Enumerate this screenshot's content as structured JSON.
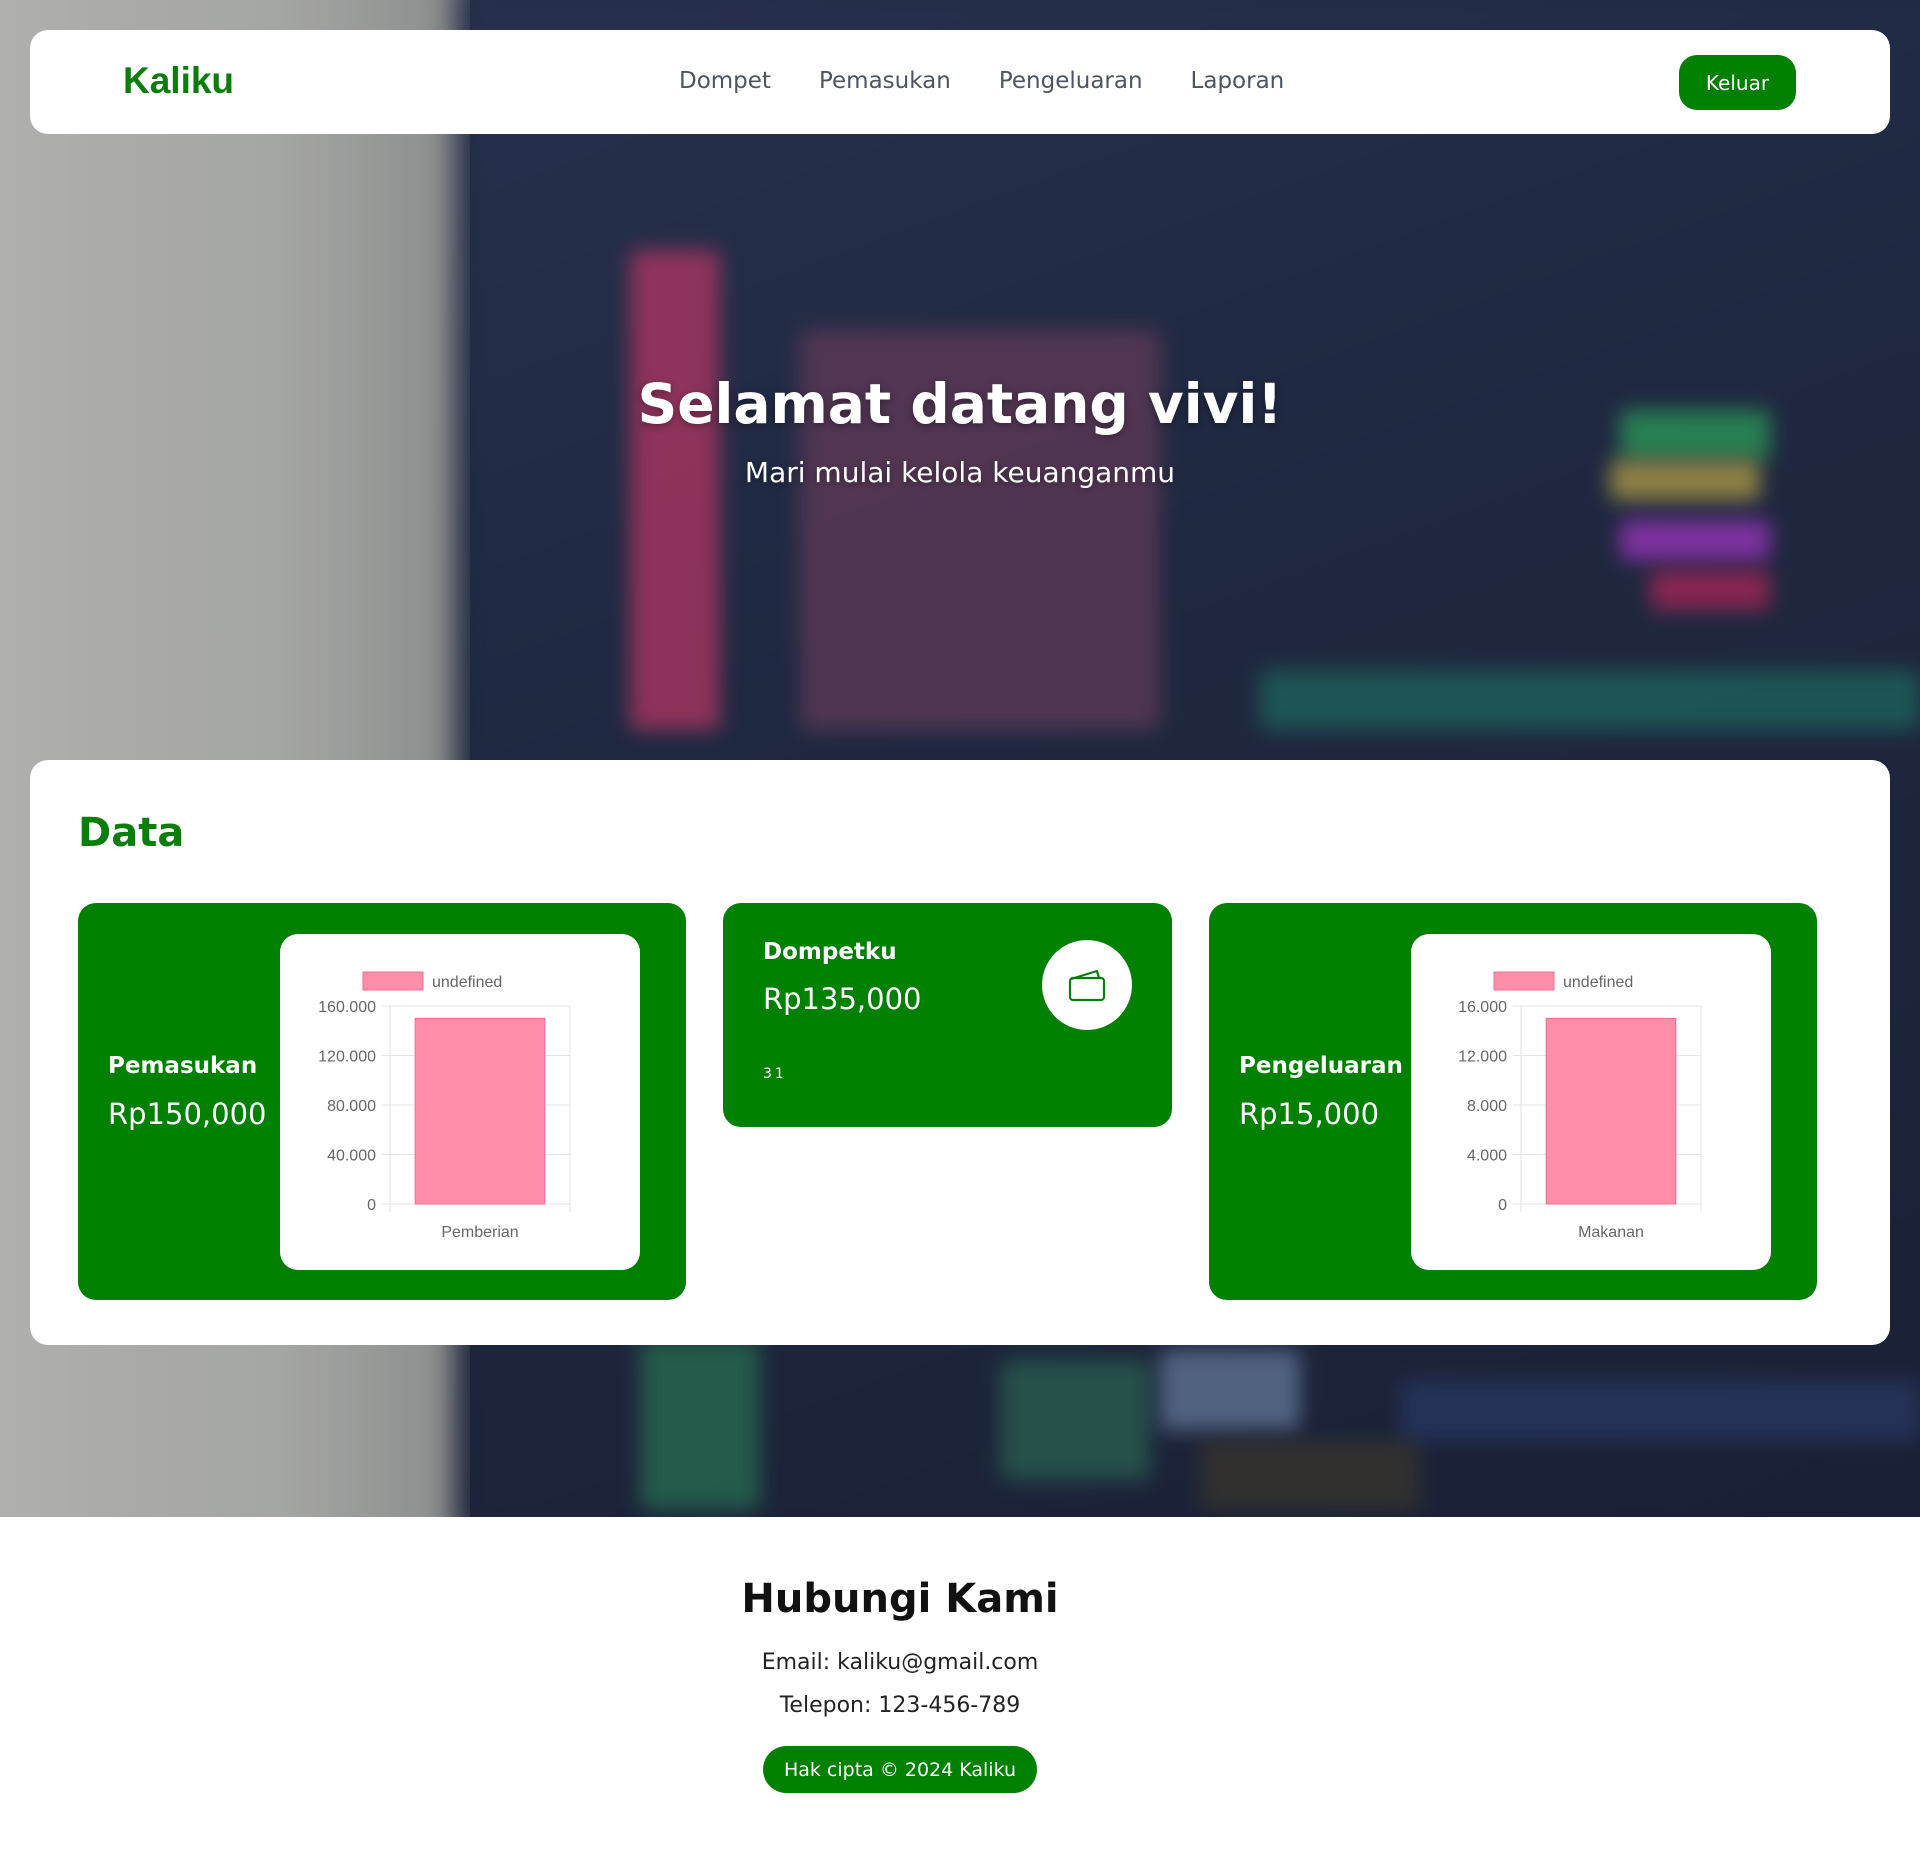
{
  "navbar": {
    "brand": "Kaliku",
    "links": [
      "Dompet",
      "Pemasukan",
      "Pengeluaran",
      "Laporan"
    ],
    "logout_label": "Keluar"
  },
  "hero": {
    "title": "Selamat datang vivi!",
    "subtitle": "Mari mulai kelola keuanganmu"
  },
  "data_section": {
    "heading": "Data",
    "income": {
      "title": "Pemasukan",
      "amount": "Rp150,000"
    },
    "wallet": {
      "title": "Dompetku",
      "amount": "Rp135,000",
      "small_text": "31",
      "icon": "wallet-icon"
    },
    "expense": {
      "title": "Pengeluaran",
      "amount": "Rp15,000"
    }
  },
  "chart_data": [
    {
      "type": "bar",
      "categories": [
        "Pemberian"
      ],
      "series": [
        {
          "name": "undefined",
          "values": [
            150000
          ]
        }
      ],
      "ylim": [
        0,
        160000
      ],
      "yticks": [
        "0",
        "40.000",
        "80.000",
        "120.000",
        "160.000"
      ],
      "grid": true,
      "legend": "top",
      "color": "#ff8fa9"
    },
    {
      "type": "bar",
      "categories": [
        "Makanan"
      ],
      "series": [
        {
          "name": "undefined",
          "values": [
            15000
          ]
        }
      ],
      "ylim": [
        0,
        16000
      ],
      "yticks": [
        "0",
        "4.000",
        "8.000",
        "12.000",
        "16.000"
      ],
      "grid": true,
      "legend": "top",
      "color": "#ff8fa9"
    }
  ],
  "footer": {
    "title": "Hubungi Kami",
    "email": "Email: kaliku@gmail.com",
    "phone": "Telepon: 123-456-789",
    "copyright": "Hak cipta © 2024 Kaliku"
  },
  "colors": {
    "brand_green": "#008000",
    "bar_fill": "#ff8fa9"
  }
}
